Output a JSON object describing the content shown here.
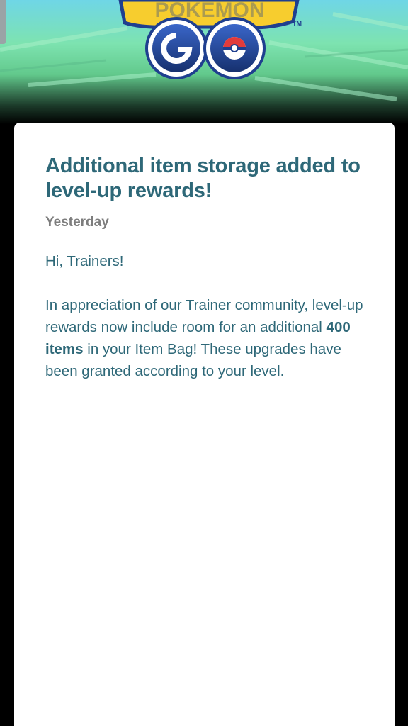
{
  "header": {
    "logo_text": "POKÉMON GO",
    "trademark": "TM"
  },
  "news": {
    "title": "Additional item storage added to level-up rewards!",
    "date": "Yesterday",
    "greeting": "Hi, Trainers!",
    "body_before": "In appreciation of our Trainer community, level-up rewards now include room for an additional ",
    "body_bold": "400 items",
    "body_after": " in your Item Bag! These upgrades have been granted according to your level."
  },
  "colors": {
    "title": "#2e6878",
    "date": "#7d7d7d",
    "card_bg": "#ffffff",
    "logo_blue": "#1f3f8f",
    "logo_yellow": "#f7cd2e"
  }
}
